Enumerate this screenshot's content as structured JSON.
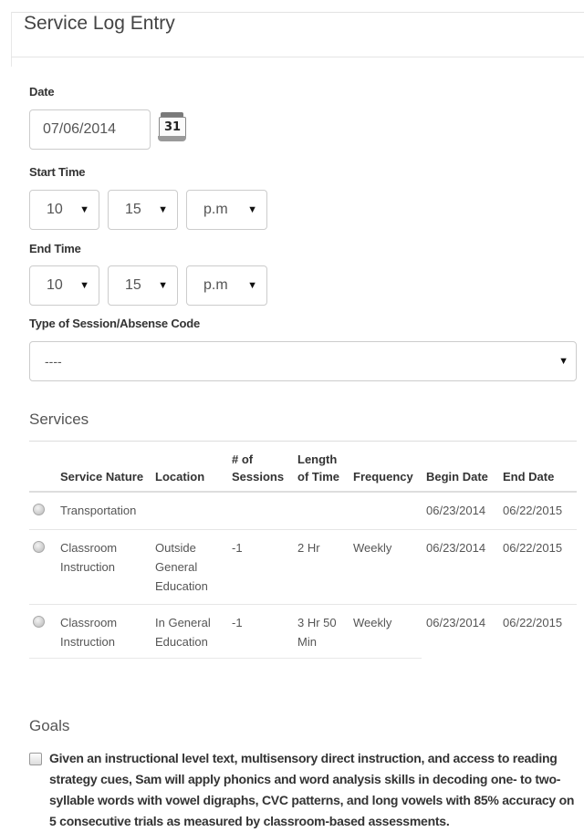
{
  "page": {
    "title": "Service Log Entry"
  },
  "date": {
    "label": "Date",
    "value": "07/06/2014",
    "calendar_day": "31"
  },
  "start_time": {
    "label": "Start Time",
    "hour": "10",
    "minute": "15",
    "period": "p.m"
  },
  "end_time": {
    "label": "End Time",
    "hour": "10",
    "minute": "15",
    "period": "p.m"
  },
  "session_type": {
    "label": "Type of Session/Absense Code",
    "value": "----"
  },
  "services": {
    "heading": "Services",
    "columns": {
      "service_nature": "Service Nature",
      "location": "Location",
      "sessions": "# of Sessions",
      "length": "Length of Time",
      "frequency": "Frequency",
      "begin_date": "Begin Date",
      "end_date": "End Date"
    },
    "rows": [
      {
        "service_nature": "Transportation",
        "location": "",
        "sessions": "",
        "length": "",
        "frequency": "",
        "begin_date": "06/23/2014",
        "end_date": "06/22/2015"
      },
      {
        "service_nature": "Classroom Instruction",
        "location": "Outside General Education",
        "sessions": "-1",
        "length": "2 Hr",
        "frequency": "Weekly",
        "begin_date": "06/23/2014",
        "end_date": "06/22/2015"
      },
      {
        "service_nature": "Classroom Instruction",
        "location": "In General Education",
        "sessions": "-1",
        "length": "3 Hr 50 Min",
        "frequency": "Weekly",
        "begin_date": "06/23/2014",
        "end_date": "06/22/2015"
      }
    ]
  },
  "goals": {
    "heading": "Goals",
    "items": [
      {
        "text": "Given an instructional level text, multisensory direct instruction, and access to reading strategy cues, Sam will apply phonics and word analysis skills in decoding one- to two-syllable words with vowel digraphs, CVC patterns, and long vowels with 85% accuracy on 5 consecutive trials as measured by classroom-based assessments."
      }
    ]
  }
}
